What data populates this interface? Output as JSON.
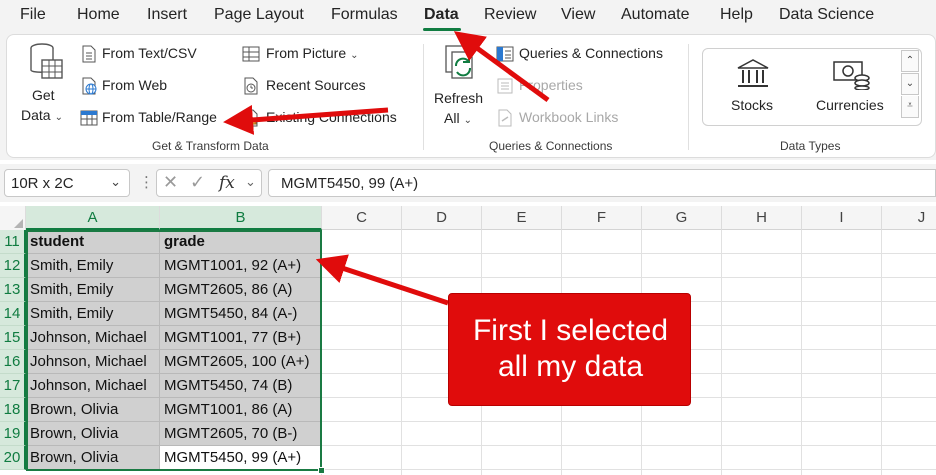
{
  "menu": {
    "items": [
      "File",
      "Home",
      "Insert",
      "Page Layout",
      "Formulas",
      "Data",
      "Review",
      "View",
      "Automate",
      "Help",
      "Data Science"
    ],
    "active": "Data"
  },
  "ribbon": {
    "get_transform": {
      "get_data_line1": "Get",
      "get_data_line2": "Data",
      "from_text_csv": "From Text/CSV",
      "from_web": "From Web",
      "from_table_range": "From Table/Range",
      "from_picture": "From Picture",
      "recent_sources": "Recent Sources",
      "existing_connections": "Existing Connections",
      "group_label": "Get & Transform Data"
    },
    "queries": {
      "refresh_line1": "Refresh",
      "refresh_line2": "All",
      "queries_connections": "Queries & Connections",
      "properties": "Properties",
      "workbook_links": "Workbook Links",
      "group_label": "Queries & Connections"
    },
    "data_types": {
      "stocks": "Stocks",
      "currencies": "Currencies",
      "group_label": "Data Types"
    }
  },
  "formula_bar": {
    "name_box": "10R x 2C",
    "fx": "fx",
    "formula": "MGMT5450, 99 (A+)"
  },
  "sheet": {
    "columns": [
      "A",
      "B",
      "C",
      "D",
      "E",
      "F",
      "G",
      "H",
      "I",
      "J"
    ],
    "row_numbers": [
      "11",
      "12",
      "13",
      "14",
      "15",
      "16",
      "17",
      "18",
      "19",
      "20"
    ],
    "rows": [
      [
        "student",
        "grade"
      ],
      [
        "Smith, Emily",
        "MGMT1001, 92 (A+)"
      ],
      [
        "Smith, Emily",
        "MGMT2605, 86 (A)"
      ],
      [
        "Smith, Emily",
        "MGMT5450, 84 (A-)"
      ],
      [
        "Johnson, Michael",
        "MGMT1001, 77 (B+)"
      ],
      [
        "Johnson, Michael",
        "MGMT2605, 100 (A+)"
      ],
      [
        "Johnson, Michael",
        "MGMT5450, 74 (B)"
      ],
      [
        "Brown, Olivia",
        "MGMT1001, 86 (A)"
      ],
      [
        "Brown, Olivia",
        "MGMT2605, 70 (B-)"
      ],
      [
        "Brown, Olivia",
        "MGMT5450, 99 (A+)"
      ]
    ]
  },
  "annotation": {
    "line1": "First I selected",
    "line2": "all my data"
  },
  "colors": {
    "accent_green": "#107c41",
    "annotation_red": "#e00c0c",
    "selection_gray": "#d0d0d0"
  }
}
